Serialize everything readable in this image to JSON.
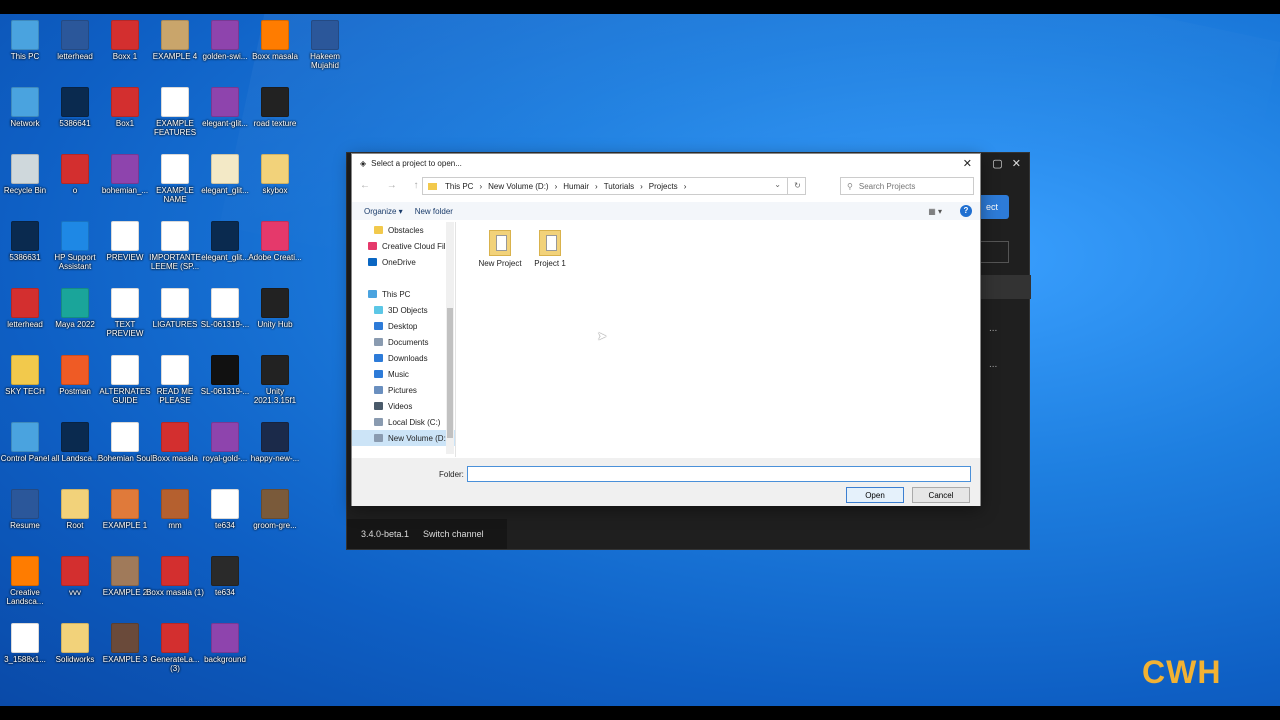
{
  "desktop_icons": [
    {
      "label": "This PC",
      "icon": "computer-icon",
      "color": "#4aa3df",
      "col": 0,
      "row": 0
    },
    {
      "label": "letterhead",
      "icon": "word-doc-icon",
      "color": "#2b579a",
      "col": 1,
      "row": 0
    },
    {
      "label": "Boxx 1",
      "icon": "pdf-icon",
      "color": "#d32f2f",
      "col": 2,
      "row": 0
    },
    {
      "label": "EXAMPLE 4",
      "icon": "image-thumbnail-icon",
      "color": "#c9a56b",
      "col": 3,
      "row": 0
    },
    {
      "label": "golden-swi...",
      "icon": "winrar-icon",
      "color": "#8e44ad",
      "col": 4,
      "row": 0
    },
    {
      "label": "Boxx masala",
      "icon": "illustrator-icon",
      "color": "#ff7c00",
      "col": 5,
      "row": 0
    },
    {
      "label": "Hakeem Mujahid",
      "icon": "word-doc-icon",
      "color": "#2b579a",
      "col": 6,
      "row": 0
    },
    {
      "label": "Network",
      "icon": "network-icon",
      "color": "#4aa3df",
      "col": 0,
      "row": 1
    },
    {
      "label": "5386641",
      "icon": "photoshop-icon",
      "color": "#0a2a4f",
      "col": 1,
      "row": 1
    },
    {
      "label": "Box1",
      "icon": "pdf-icon",
      "color": "#d32f2f",
      "col": 2,
      "row": 1
    },
    {
      "label": "EXAMPLE FEATURES",
      "icon": "image-thumbnail-icon",
      "color": "#ffffff",
      "col": 3,
      "row": 1
    },
    {
      "label": "elegant-glit...",
      "icon": "winrar-icon",
      "color": "#8e44ad",
      "col": 4,
      "row": 1
    },
    {
      "label": "road texture",
      "icon": "image-thumbnail-icon",
      "color": "#222222",
      "col": 5,
      "row": 1
    },
    {
      "label": "Recycle Bin",
      "icon": "recycle-bin-icon",
      "color": "#cfd8dc",
      "col": 0,
      "row": 2
    },
    {
      "label": "o",
      "icon": "pdf-icon",
      "color": "#d32f2f",
      "col": 1,
      "row": 2
    },
    {
      "label": "bohemian_...",
      "icon": "winrar-icon",
      "color": "#8e44ad",
      "col": 2,
      "row": 2
    },
    {
      "label": "EXAMPLE NAME",
      "icon": "image-thumbnail-icon",
      "color": "#ffffff",
      "col": 3,
      "row": 2
    },
    {
      "label": "elegant_glit...",
      "icon": "image-thumbnail-icon",
      "color": "#f3e9c6",
      "col": 4,
      "row": 2
    },
    {
      "label": "skybox",
      "icon": "file-icon",
      "color": "#f2d27a",
      "col": 5,
      "row": 2
    },
    {
      "label": "5386631",
      "icon": "photoshop-icon",
      "color": "#0a2a4f",
      "col": 0,
      "row": 3
    },
    {
      "label": "HP Support Assistant",
      "icon": "help-icon",
      "color": "#1e88e5",
      "col": 1,
      "row": 3
    },
    {
      "label": "PREVIEW",
      "icon": "image-thumbnail-icon",
      "color": "#ffffff",
      "col": 2,
      "row": 3
    },
    {
      "label": "IMPORTANTE LEEME (SP...",
      "icon": "text-file-icon",
      "color": "#ffffff",
      "col": 3,
      "row": 3
    },
    {
      "label": "elegant_glit...",
      "icon": "photoshop-icon",
      "color": "#0a2a4f",
      "col": 4,
      "row": 3
    },
    {
      "label": "Adobe Creati...",
      "icon": "creative-cloud-icon",
      "color": "#e5396b",
      "col": 5,
      "row": 3
    },
    {
      "label": "letterhead",
      "icon": "pdf-icon",
      "color": "#d32f2f",
      "col": 0,
      "row": 4
    },
    {
      "label": "Maya 2022",
      "icon": "maya-icon",
      "color": "#1aa59a",
      "col": 1,
      "row": 4
    },
    {
      "label": "TEXT PREVIEW",
      "icon": "image-thumbnail-icon",
      "color": "#ffffff",
      "col": 2,
      "row": 4
    },
    {
      "label": "LIGATURES",
      "icon": "image-thumbnail-icon",
      "color": "#ffffff",
      "col": 3,
      "row": 4
    },
    {
      "label": "SL-061319-...",
      "icon": "eps-icon",
      "color": "#ffffff",
      "col": 4,
      "row": 4
    },
    {
      "label": "Unity Hub",
      "icon": "unity-icon",
      "color": "#222222",
      "col": 5,
      "row": 4
    },
    {
      "label": "SKY TECH",
      "icon": "folder-icon",
      "color": "#f2c94c",
      "col": 0,
      "row": 5
    },
    {
      "label": "Postman",
      "icon": "postman-icon",
      "color": "#ef5b25",
      "col": 1,
      "row": 5
    },
    {
      "label": "ALTERNATES GUIDE",
      "icon": "image-thumbnail-icon",
      "color": "#ffffff",
      "col": 2,
      "row": 5
    },
    {
      "label": "READ ME PLEASE",
      "icon": "text-file-icon",
      "color": "#ffffff",
      "col": 3,
      "row": 5
    },
    {
      "label": "SL-061319-...",
      "icon": "image-thumbnail-icon",
      "color": "#111111",
      "col": 4,
      "row": 5
    },
    {
      "label": "Unity 2021.3.15f1",
      "icon": "unity-icon",
      "color": "#222222",
      "col": 5,
      "row": 5
    },
    {
      "label": "Control Panel",
      "icon": "control-panel-icon",
      "color": "#4aa3df",
      "col": 0,
      "row": 6
    },
    {
      "label": "all Landsca...",
      "icon": "photoshop-icon",
      "color": "#0a2a4f",
      "col": 1,
      "row": 6
    },
    {
      "label": "Bohemian Soul",
      "icon": "font-file-icon",
      "color": "#ffffff",
      "col": 2,
      "row": 6
    },
    {
      "label": "Boxx masala",
      "icon": "pdf-icon",
      "color": "#d32f2f",
      "col": 3,
      "row": 6
    },
    {
      "label": "royal-gold-...",
      "icon": "winrar-icon",
      "color": "#8e44ad",
      "col": 4,
      "row": 6
    },
    {
      "label": "happy-new-...",
      "icon": "image-thumbnail-icon",
      "color": "#1b2a4a",
      "col": 5,
      "row": 6
    },
    {
      "label": "Resume",
      "icon": "word-doc-icon",
      "color": "#2b579a",
      "col": 0,
      "row": 7
    },
    {
      "label": "Root",
      "icon": "file-icon",
      "color": "#f2d27a",
      "col": 1,
      "row": 7
    },
    {
      "label": "EXAMPLE 1",
      "icon": "image-thumbnail-icon",
      "color": "#e07a3a",
      "col": 2,
      "row": 7
    },
    {
      "label": "mm",
      "icon": "image-thumbnail-icon",
      "color": "#b5602f",
      "col": 3,
      "row": 7
    },
    {
      "label": "te634",
      "icon": "eps-icon",
      "color": "#ffffff",
      "col": 4,
      "row": 7
    },
    {
      "label": "groom-gre...",
      "icon": "image-thumbnail-icon",
      "color": "#7a5a3a",
      "col": 5,
      "row": 7
    },
    {
      "label": "Creative Landsca...",
      "icon": "illustrator-icon",
      "color": "#ff7c00",
      "col": 0,
      "row": 8
    },
    {
      "label": "vvv",
      "icon": "pdf-icon",
      "color": "#d32f2f",
      "col": 1,
      "row": 8
    },
    {
      "label": "EXAMPLE 2",
      "icon": "image-thumbnail-icon",
      "color": "#a07a5a",
      "col": 2,
      "row": 8
    },
    {
      "label": "Boxx masala (1)",
      "icon": "pdf-icon",
      "color": "#d32f2f",
      "col": 3,
      "row": 8
    },
    {
      "label": "te634",
      "icon": "image-thumbnail-icon",
      "color": "#2a2a2a",
      "col": 4,
      "row": 8
    },
    {
      "label": "3_1588x1...",
      "icon": "image-file-icon",
      "color": "#ffffff",
      "col": 0,
      "row": 9
    },
    {
      "label": "Solidworks",
      "icon": "file-icon",
      "color": "#f2d27a",
      "col": 1,
      "row": 9
    },
    {
      "label": "EXAMPLE 3",
      "icon": "image-thumbnail-icon",
      "color": "#6a4a3a",
      "col": 2,
      "row": 9
    },
    {
      "label": "GenerateLa... (3)",
      "icon": "pdf-icon",
      "color": "#d32f2f",
      "col": 3,
      "row": 9
    },
    {
      "label": "background",
      "icon": "winrar-icon",
      "color": "#8e44ad",
      "col": 4,
      "row": 9
    }
  ],
  "dark_app": {
    "button_label": "ect",
    "version": "3.4.0-beta.1",
    "switch_channel": "Switch channel",
    "dots": "..."
  },
  "dialog": {
    "title": "Select a project to open...",
    "close": "✕",
    "nav": "← → ↑",
    "breadcrumbs": [
      "This PC",
      "New Volume (D:)",
      "Humair",
      "Tutorials",
      "Projects"
    ],
    "search_placeholder": "Search Projects",
    "toolbar": {
      "organize": "Organize ▾",
      "new_folder": "New folder",
      "view": "▦ ▾",
      "help": "?"
    },
    "sidebar": [
      {
        "label": "Obstacles",
        "icon": "folder-icon",
        "color": "#f2c94c",
        "indent": 1,
        "selected": false
      },
      {
        "label": "Creative Cloud Fil",
        "icon": "creative-cloud-folder-icon",
        "color": "#e5396b",
        "indent": 0,
        "selected": false
      },
      {
        "label": "OneDrive",
        "icon": "onedrive-icon",
        "color": "#0a66c2",
        "indent": 0,
        "selected": false
      },
      {
        "label": "",
        "icon": "",
        "color": "",
        "indent": 0,
        "selected": false
      },
      {
        "label": "This PC",
        "icon": "computer-icon",
        "color": "#4aa3df",
        "indent": 0,
        "selected": false
      },
      {
        "label": "3D Objects",
        "icon": "3d-objects-icon",
        "color": "#5cc7e6",
        "indent": 1,
        "selected": false
      },
      {
        "label": "Desktop",
        "icon": "desktop-icon",
        "color": "#2d7bd8",
        "indent": 1,
        "selected": false
      },
      {
        "label": "Documents",
        "icon": "documents-icon",
        "color": "#8a9bb0",
        "indent": 1,
        "selected": false
      },
      {
        "label": "Downloads",
        "icon": "downloads-icon",
        "color": "#2d7bd8",
        "indent": 1,
        "selected": false
      },
      {
        "label": "Music",
        "icon": "music-icon",
        "color": "#2d7bd8",
        "indent": 1,
        "selected": false
      },
      {
        "label": "Pictures",
        "icon": "pictures-icon",
        "color": "#6a8fbf",
        "indent": 1,
        "selected": false
      },
      {
        "label": "Videos",
        "icon": "videos-icon",
        "color": "#4a5a6a",
        "indent": 1,
        "selected": false
      },
      {
        "label": "Local Disk (C:)",
        "icon": "drive-icon",
        "color": "#8a9bb0",
        "indent": 1,
        "selected": false
      },
      {
        "label": "New Volume (D:",
        "icon": "drive-icon",
        "color": "#8a9bb0",
        "indent": 1,
        "selected": true
      }
    ],
    "files": [
      {
        "label": "New Project",
        "icon": "unity-project-folder-icon"
      },
      {
        "label": "Project 1",
        "icon": "unity-project-folder-icon"
      }
    ],
    "folder_label": "Folder:",
    "folder_value": "",
    "open": "Open",
    "cancel": "Cancel"
  },
  "watermark": "CWH",
  "colors": {
    "accent": "#2d7bd8",
    "watermark": "#f2b233"
  }
}
